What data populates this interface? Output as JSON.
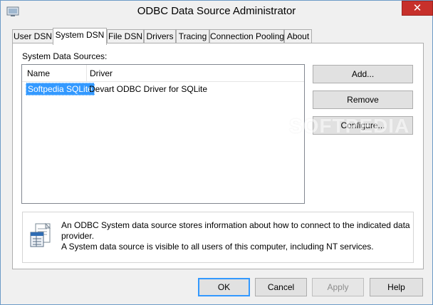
{
  "window": {
    "title": "ODBC Data Source Administrator",
    "close_glyph": "✕"
  },
  "tabs": [
    {
      "label": "User DSN",
      "active": false
    },
    {
      "label": "System DSN",
      "active": true
    },
    {
      "label": "File DSN",
      "active": false
    },
    {
      "label": "Drivers",
      "active": false
    },
    {
      "label": "Tracing",
      "active": false
    },
    {
      "label": "Connection Pooling",
      "active": false
    },
    {
      "label": "About",
      "active": false
    }
  ],
  "system_dsn": {
    "group_label": "System Data Sources:",
    "columns": [
      "Name",
      "Driver"
    ],
    "rows": [
      {
        "name": "Softpedia SQLite",
        "driver": "Devart ODBC Driver for SQLite",
        "selected": true
      }
    ],
    "buttons": {
      "add": "Add...",
      "remove": "Remove",
      "configure": "Configure..."
    },
    "info": {
      "line1": "An ODBC System data source stores information about how to connect to the indicated data provider.",
      "line2": "A System data source is visible to all users of this computer, including NT services.",
      "icon": "data-sources-icon"
    }
  },
  "footer_buttons": {
    "ok": "OK",
    "cancel": "Cancel",
    "apply": "Apply",
    "help": "Help"
  },
  "watermark": "SOFTPEDIA",
  "colors": {
    "selection": "#3399ff",
    "close_button": "#c7302b",
    "window_border": "#6d9bc7"
  }
}
